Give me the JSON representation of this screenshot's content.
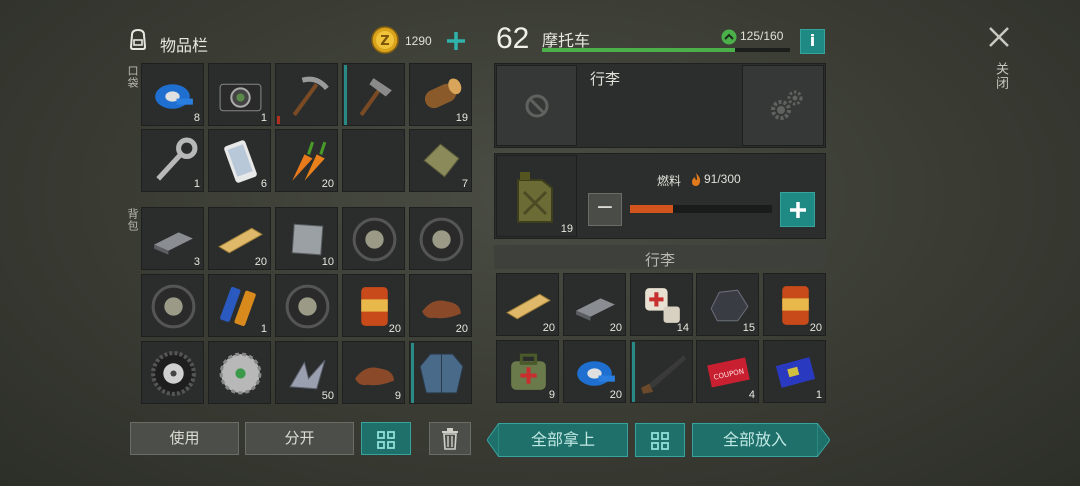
{
  "inventory": {
    "title": "物品栏",
    "coins": "1290",
    "section_pocket": "口袋",
    "section_backpack": "背包",
    "pocket_items": [
      {
        "icon": "duct-tape-icon",
        "count": "8"
      },
      {
        "icon": "camera-icon",
        "count": "1"
      },
      {
        "icon": "pickaxe-icon",
        "count": ""
      },
      {
        "icon": "hammer-icon",
        "count": ""
      },
      {
        "icon": "log-icon",
        "count": "19"
      },
      {
        "icon": "wrench-icon",
        "count": "1"
      },
      {
        "icon": "smartphone-icon",
        "count": "6"
      },
      {
        "icon": "carrot-icon",
        "count": "20"
      },
      {
        "icon": "empty-slot",
        "count": ""
      },
      {
        "icon": "cloth-icon",
        "count": "7"
      }
    ],
    "backpack_items": [
      {
        "icon": "iron-bar-icon",
        "count": "3"
      },
      {
        "icon": "wood-plank-icon",
        "count": "20"
      },
      {
        "icon": "metal-plate-icon",
        "count": "10"
      },
      {
        "icon": "tire-icon",
        "count": ""
      },
      {
        "icon": "tire-icon",
        "count": ""
      },
      {
        "icon": "tire-icon",
        "count": ""
      },
      {
        "icon": "batteries-icon",
        "count": "1"
      },
      {
        "icon": "tire-icon",
        "count": ""
      },
      {
        "icon": "food-can-icon",
        "count": "20"
      },
      {
        "icon": "leather-icon",
        "count": "20"
      },
      {
        "icon": "wheel-icon",
        "count": ""
      },
      {
        "icon": "saw-blade-icon",
        "count": ""
      },
      {
        "icon": "metal-scrap-icon",
        "count": "50"
      },
      {
        "icon": "leather-icon",
        "count": "9"
      },
      {
        "icon": "jacket-icon",
        "count": ""
      }
    ],
    "use_label": "使用",
    "split_label": "分开"
  },
  "vehicle": {
    "level": "62",
    "name": "摩托车",
    "capacity": "125/160",
    "capacity_fraction": 0.78,
    "luggage_label": "行李",
    "fuel_label": "燃料",
    "fuel_value": "91/300",
    "fuel_fraction": 0.3,
    "fuel_item_count": "19",
    "storage_label": "行李",
    "storage_items": [
      {
        "icon": "wood-plank-icon",
        "count": "20"
      },
      {
        "icon": "iron-bar-icon",
        "count": "20"
      },
      {
        "icon": "bandage-icon",
        "count": "14"
      },
      {
        "icon": "coal-icon",
        "count": "15"
      },
      {
        "icon": "food-can-icon",
        "count": "20"
      },
      {
        "icon": "medkit-bag-icon",
        "count": "9"
      },
      {
        "icon": "duct-tape-icon",
        "count": "20"
      },
      {
        "icon": "shotgun-icon",
        "count": ""
      },
      {
        "icon": "coupon-icon",
        "count": "4"
      },
      {
        "icon": "circuit-board-icon",
        "count": "1"
      }
    ],
    "take_all_label": "全部拿上",
    "put_all_label": "全部放入"
  },
  "close_label": "关闭",
  "colors": {
    "accent": "#1f6f6a",
    "accent_border": "#36a39c",
    "capacity_bar": "#4bb04a",
    "fuel_bar": "#d0541c"
  }
}
